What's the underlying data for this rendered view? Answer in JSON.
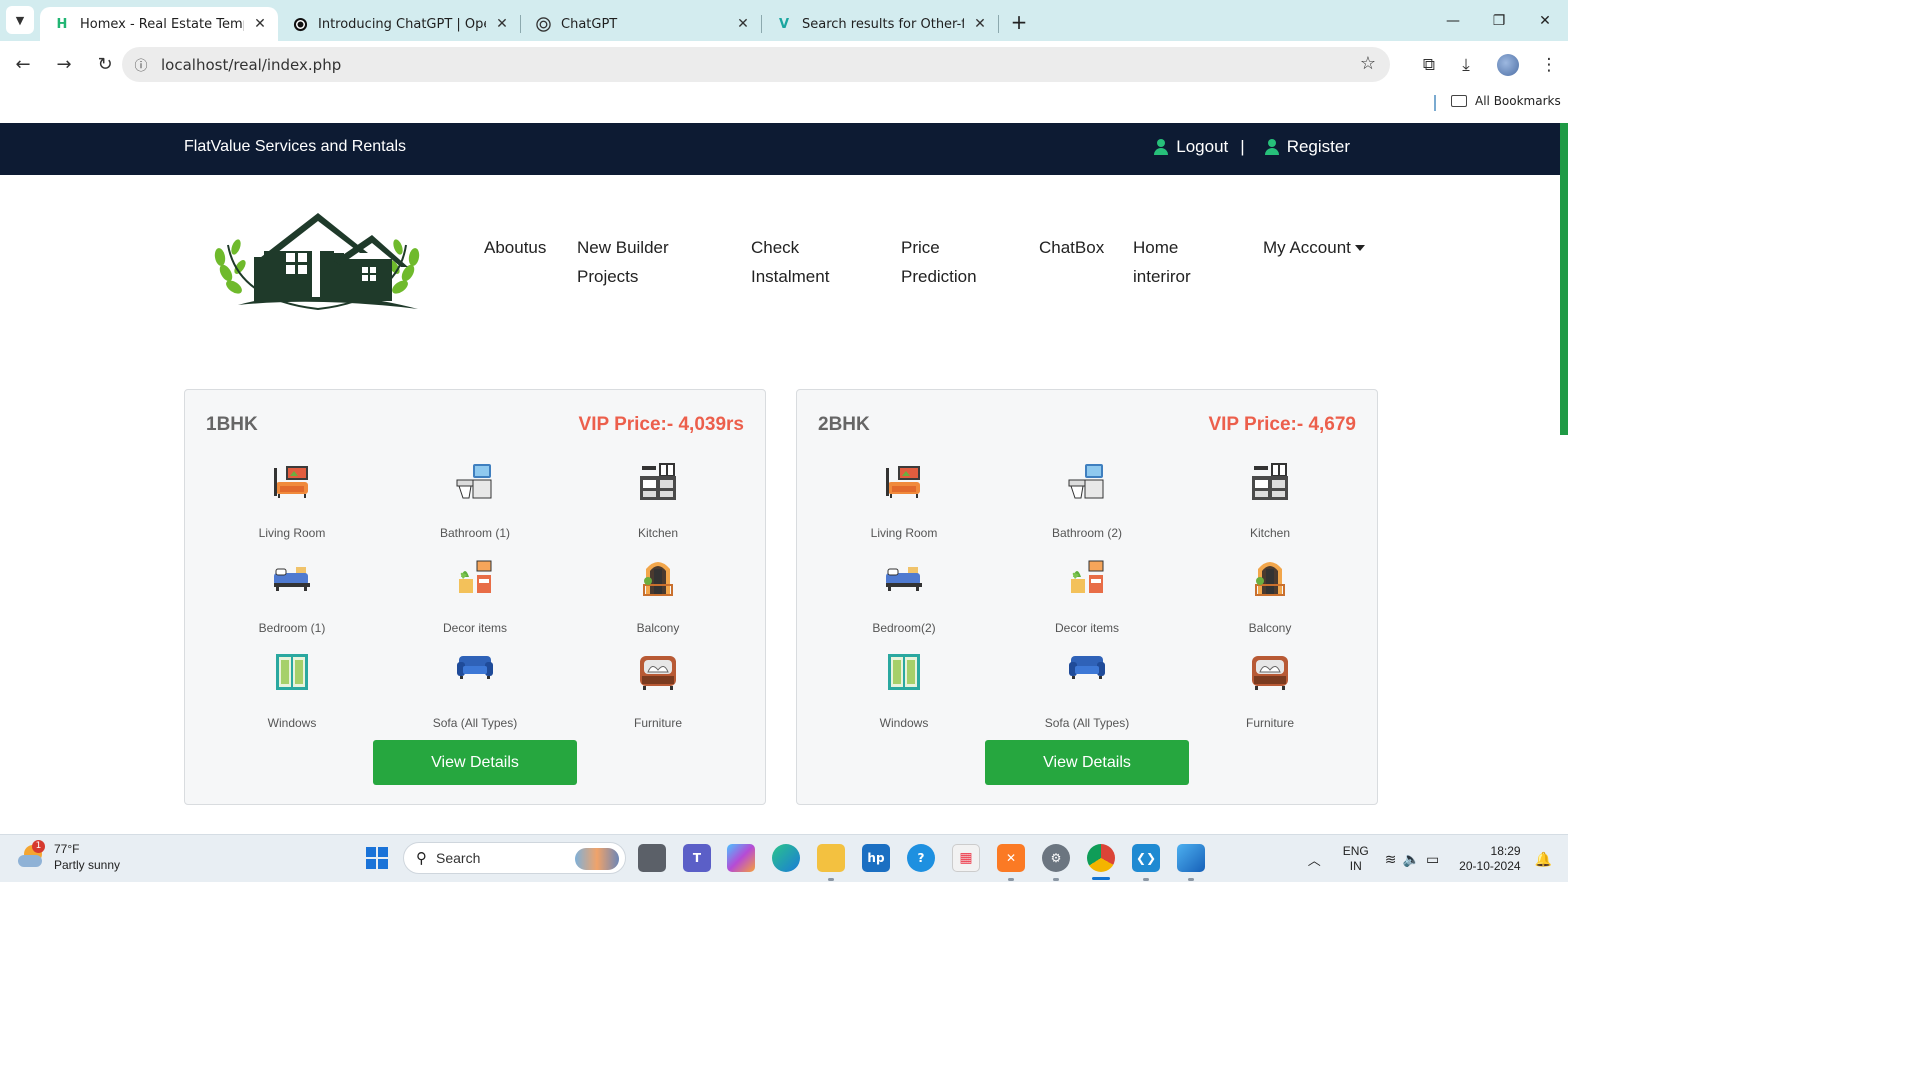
{
  "browser": {
    "tabs": [
      {
        "title": "Homex - Real Estate Template",
        "favicon": "H",
        "active": true
      },
      {
        "title": "Introducing ChatGPT | OpenAI",
        "favicon": "openai-logo",
        "active": false
      },
      {
        "title": "ChatGPT",
        "favicon": "openai-logo",
        "active": false
      },
      {
        "title": "Search results for Other-furniture",
        "favicon": "V",
        "active": false
      }
    ],
    "url": "localhost/real/index.php",
    "bookmarks_label": "All Bookmarks"
  },
  "site": {
    "brand": "FlatValue Services and Rentals",
    "logout": "Logout",
    "register": "Register",
    "separator": "|",
    "nav": [
      {
        "line1": "Aboutus",
        "line2": ""
      },
      {
        "line1": "New Builder",
        "line2": "Projects"
      },
      {
        "line1": "Check",
        "line2": "Instalment"
      },
      {
        "line1": "Price",
        "line2": "Prediction"
      },
      {
        "line1": "ChatBox",
        "line2": ""
      },
      {
        "line1": "Home",
        "line2": "interiror"
      },
      {
        "line1": "My Account",
        "line2": ""
      }
    ],
    "accent_color": "#26a73f",
    "price_color": "#ec5f4c",
    "topbar_color": "#0d1b33"
  },
  "cards": [
    {
      "type": "1BHK",
      "price": "VIP Price:- 4,039rs",
      "features": [
        "Living Room",
        "Bathroom (1)",
        "Kitchen",
        "Bedroom (1)",
        "Decor items",
        "Balcony",
        "Windows",
        "Sofa (All Types)",
        "Furniture"
      ],
      "button": "View Details"
    },
    {
      "type": "2BHK",
      "price": "VIP Price:- 4,679",
      "features": [
        "Living Room",
        "Bathroom (2)",
        "Kitchen",
        "Bedroom(2)",
        "Decor items",
        "Balcony",
        "Windows",
        "Sofa (All Types)",
        "Furniture"
      ],
      "button": "View Details"
    }
  ],
  "taskbar": {
    "weather_temp": "77°F",
    "weather_desc": "Partly sunny",
    "weather_badge": "1",
    "search_placeholder": "Search",
    "lang1": "ENG",
    "lang2": "IN",
    "time": "18:29",
    "date": "20-10-2024"
  }
}
